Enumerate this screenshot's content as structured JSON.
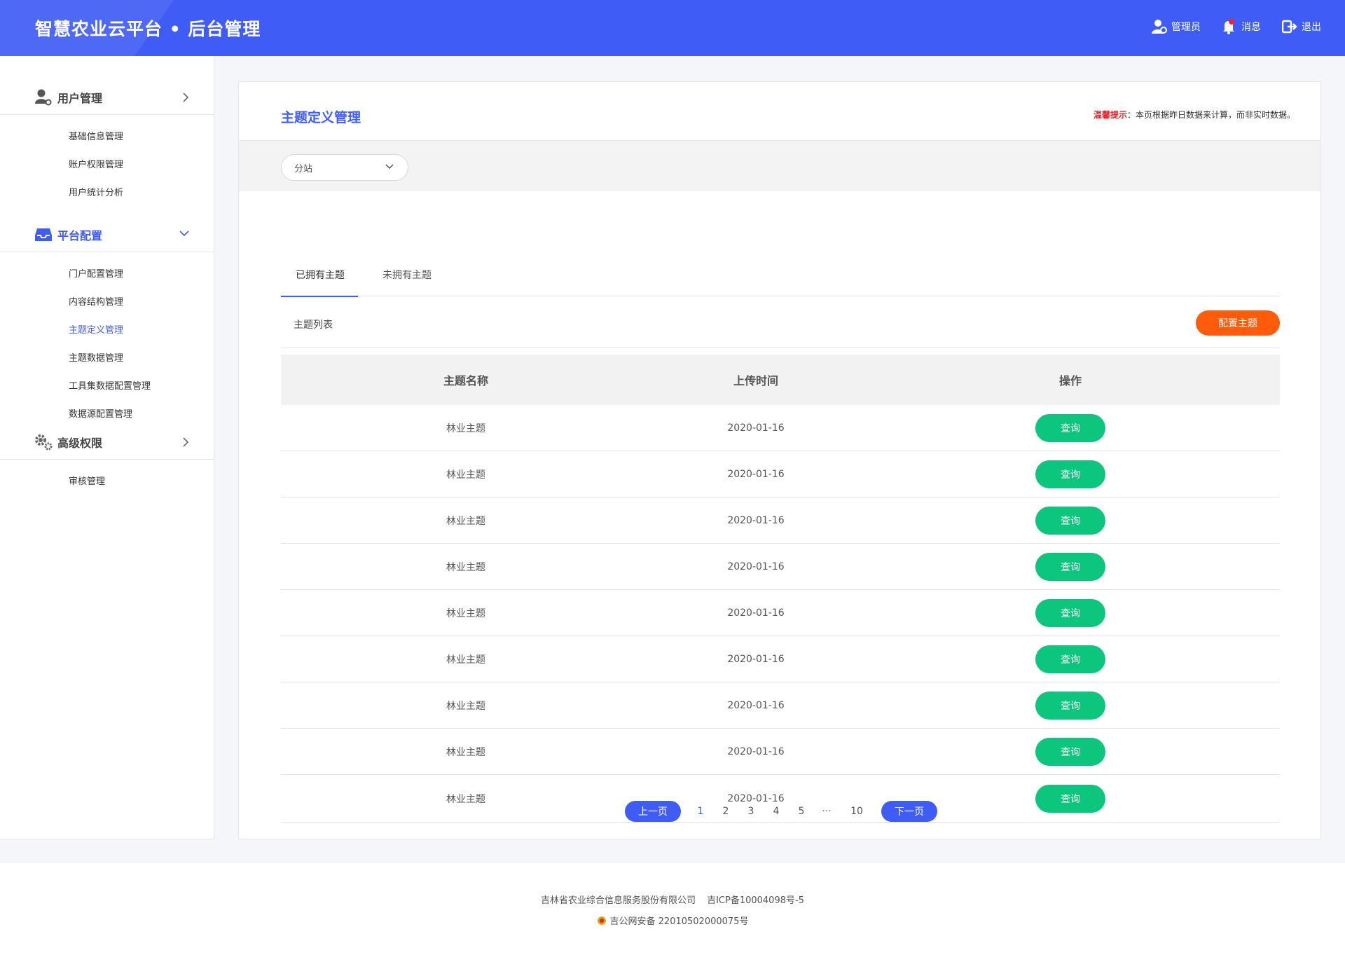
{
  "header": {
    "title": "智慧农业云平台 • 后台管理",
    "admin_label": "管理员",
    "message_label": "消息",
    "logout_label": "退出"
  },
  "sidebar": {
    "groups": [
      {
        "label": "用户管理",
        "icon": "user-gear-icon",
        "items": [
          "基础信息管理",
          "账户权限管理",
          "用户统计分析"
        ]
      },
      {
        "label": "平台配置",
        "icon": "inbox-icon",
        "items": [
          "门户配置管理",
          "内容结构管理",
          "主题定义管理",
          "主题数据管理",
          "工具集数据配置管理",
          "数据源配置管理"
        ]
      },
      {
        "label": "高级权限",
        "icon": "gears-icon",
        "items": [
          "审核管理"
        ]
      }
    ],
    "active_item": "主题定义管理"
  },
  "main": {
    "title": "主题定义管理",
    "tip_label": "温馨提示",
    "tip_text": "：本页根据昨日数据来计算，而非实时数据。",
    "select_value": "分站",
    "tabs": [
      "已拥有主题",
      "未拥有主题"
    ],
    "list_title": "主题列表",
    "config_button": "配置主题",
    "table": {
      "headers": [
        "主题名称",
        "上传时间",
        "操作"
      ],
      "rows": [
        {
          "name": "林业主题",
          "date": "2020-01-16",
          "action": "查询"
        },
        {
          "name": "林业主题",
          "date": "2020-01-16",
          "action": "查询"
        },
        {
          "name": "林业主题",
          "date": "2020-01-16",
          "action": "查询"
        },
        {
          "name": "林业主题",
          "date": "2020-01-16",
          "action": "查询"
        },
        {
          "name": "林业主题",
          "date": "2020-01-16",
          "action": "查询"
        },
        {
          "name": "林业主题",
          "date": "2020-01-16",
          "action": "查询"
        },
        {
          "name": "林业主题",
          "date": "2020-01-16",
          "action": "查询"
        },
        {
          "name": "林业主题",
          "date": "2020-01-16",
          "action": "查询"
        },
        {
          "name": "林业主题",
          "date": "2020-01-16",
          "action": "查询"
        }
      ]
    },
    "pagination": {
      "prev": "上一页",
      "pages": [
        "1",
        "2",
        "3",
        "4",
        "5",
        "···",
        "10"
      ],
      "current": "1",
      "next": "下一页"
    }
  },
  "footer": {
    "company": "吉林省农业综合信息服务股份有限公司",
    "icp": "吉ICP备10004098号-5",
    "police": "吉公网安备 22010502000075号"
  },
  "colors": {
    "primary": "#3f5df6",
    "orange": "#fe5b0a",
    "green": "#0dc67d",
    "tip_red": "#f5222d"
  }
}
